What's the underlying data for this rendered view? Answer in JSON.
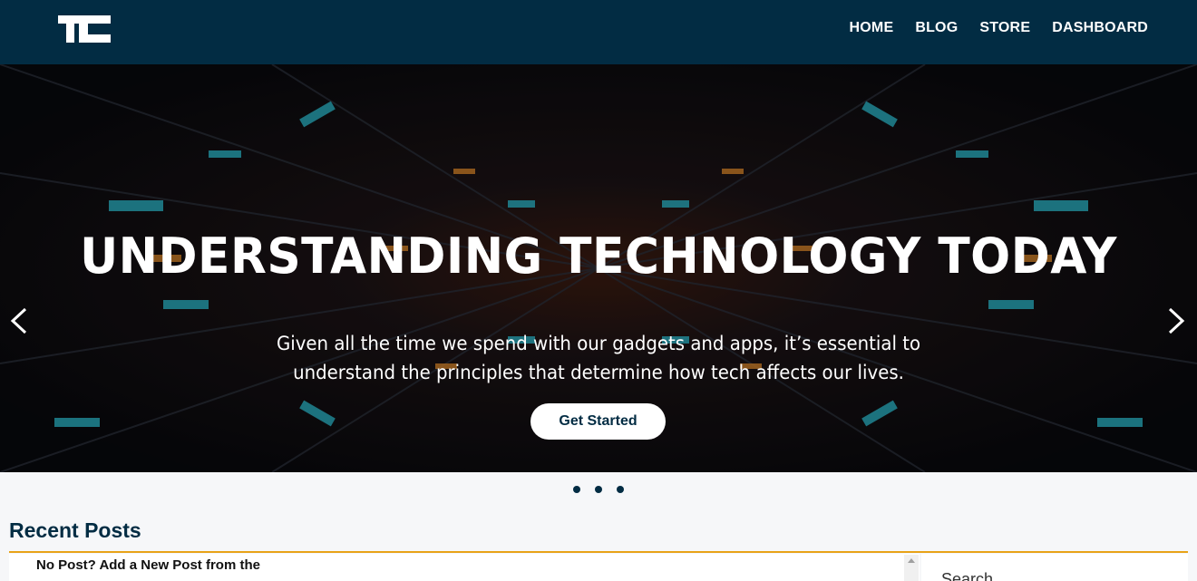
{
  "header": {
    "logo_text": "TC",
    "nav": [
      {
        "label": "HOME"
      },
      {
        "label": "BLOG"
      },
      {
        "label": "STORE"
      },
      {
        "label": "DASHBOARD"
      }
    ]
  },
  "hero": {
    "title": "UNDERSTANDING TECHNOLOGY TODAY",
    "subtitle": "Given all the time we spend with our gadgets and apps, it’s essential to understand the principles that determine how tech affects our lives.",
    "cta_label": "Get Started",
    "slide_count": 3
  },
  "recent_posts": {
    "title": "Recent Posts",
    "empty_message": "No Post? Add a New Post from the"
  },
  "sidebar": {
    "search_label": "Search"
  },
  "colors": {
    "header_bg": "#022c43",
    "accent": "#e8a318",
    "page_bg": "#f6f7f9"
  },
  "icons": {
    "prev": "chevron-left-icon",
    "next": "chevron-right-icon",
    "logo": "tc-logo-icon"
  }
}
